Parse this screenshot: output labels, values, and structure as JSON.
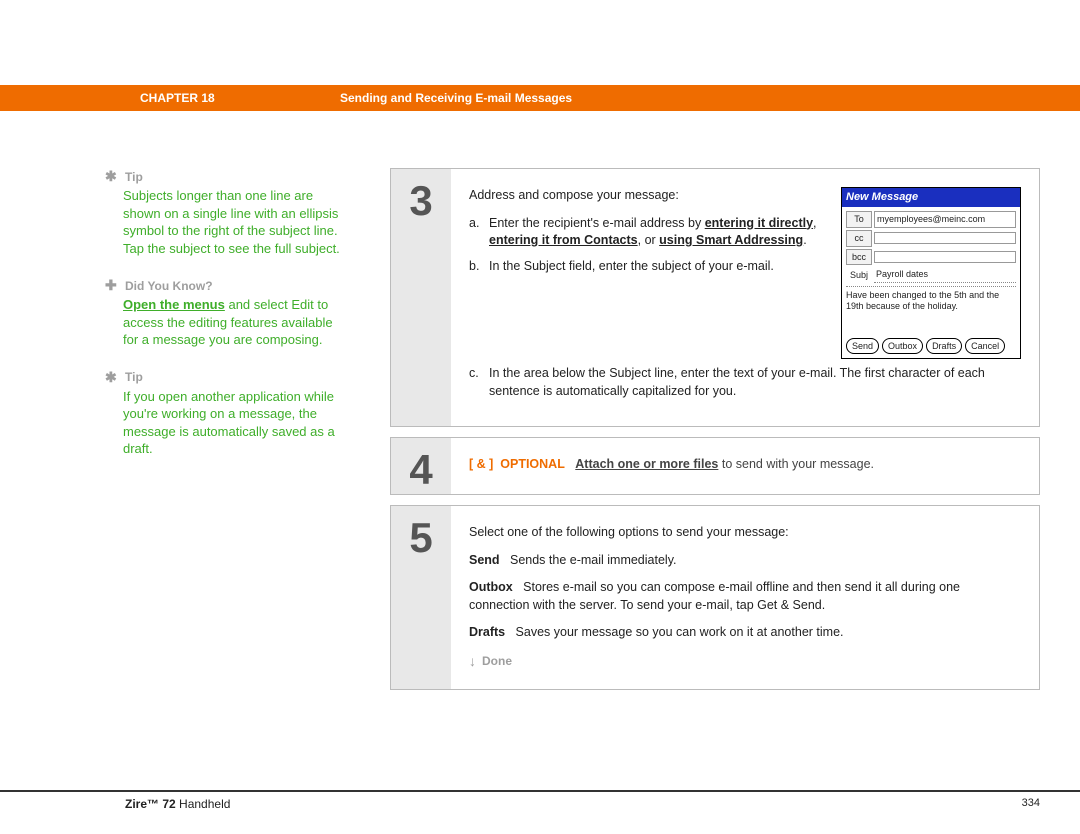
{
  "header": {
    "chapter": "CHAPTER 18",
    "title": "Sending and Receiving E-mail Messages"
  },
  "sidebar": {
    "blocks": [
      {
        "icon": "asterisk",
        "label": "Tip",
        "text": "Subjects longer than one line are shown on a single line with an ellipsis symbol to the right of the subject line. Tap the subject to see the full subject."
      },
      {
        "icon": "plus",
        "label": "Did You Know?",
        "linkText": "Open the menus",
        "text": " and select Edit to access the editing features available for a message you are composing."
      },
      {
        "icon": "asterisk",
        "label": "Tip",
        "text": "If you open another application while you're working on a message, the message is automatically saved as a draft."
      }
    ]
  },
  "steps": {
    "s3": {
      "num": "3",
      "lead": "Address and compose your message:",
      "items": [
        {
          "l": "a.",
          "pre": "Enter the recipient's e-mail address by ",
          "b1": "entering it directly",
          "mid": ", ",
          "b2": "entering it from Contacts",
          "mid2": ", or ",
          "b3": "using Smart Addressing",
          "post": "."
        },
        {
          "l": "b.",
          "t": "In the Subject field, enter the subject of your e-mail."
        },
        {
          "l": "c.",
          "t": "In the area below the Subject line, enter the text of your e-mail. The first character of each sentence is automatically capitalized for you."
        }
      ],
      "device": {
        "title": "New Message",
        "to_label": "To",
        "to_value": "myemployees@meinc.com",
        "cc_label": "cc",
        "cc_value": "",
        "bcc_label": "bcc",
        "bcc_value": "",
        "subj_label": "Subj",
        "subj_value": "Payroll dates",
        "body": "Have been changed to the 5th and the 19th because of the holiday.",
        "buttons": [
          "Send",
          "Outbox",
          "Drafts",
          "Cancel"
        ]
      }
    },
    "s4": {
      "num": "4",
      "bracket": "[ & ]",
      "optional": "OPTIONAL",
      "link": "Attach one or more files",
      "rest": " to send with your message."
    },
    "s5": {
      "num": "5",
      "lead": "Select one of the following options to send your message:",
      "rows": [
        {
          "h": "Send",
          "t": "Sends the e-mail immediately."
        },
        {
          "h": "Outbox",
          "t": "Stores e-mail so you can compose e-mail offline and then send it all during one connection with the server. To send your e-mail, tap Get & Send."
        },
        {
          "h": "Drafts",
          "t": "Saves your message so you can work on it at another time."
        }
      ],
      "done": "Done"
    }
  },
  "footer": {
    "product_bold": "Zire™ 72",
    "product_rest": " Handheld",
    "page": "334"
  }
}
